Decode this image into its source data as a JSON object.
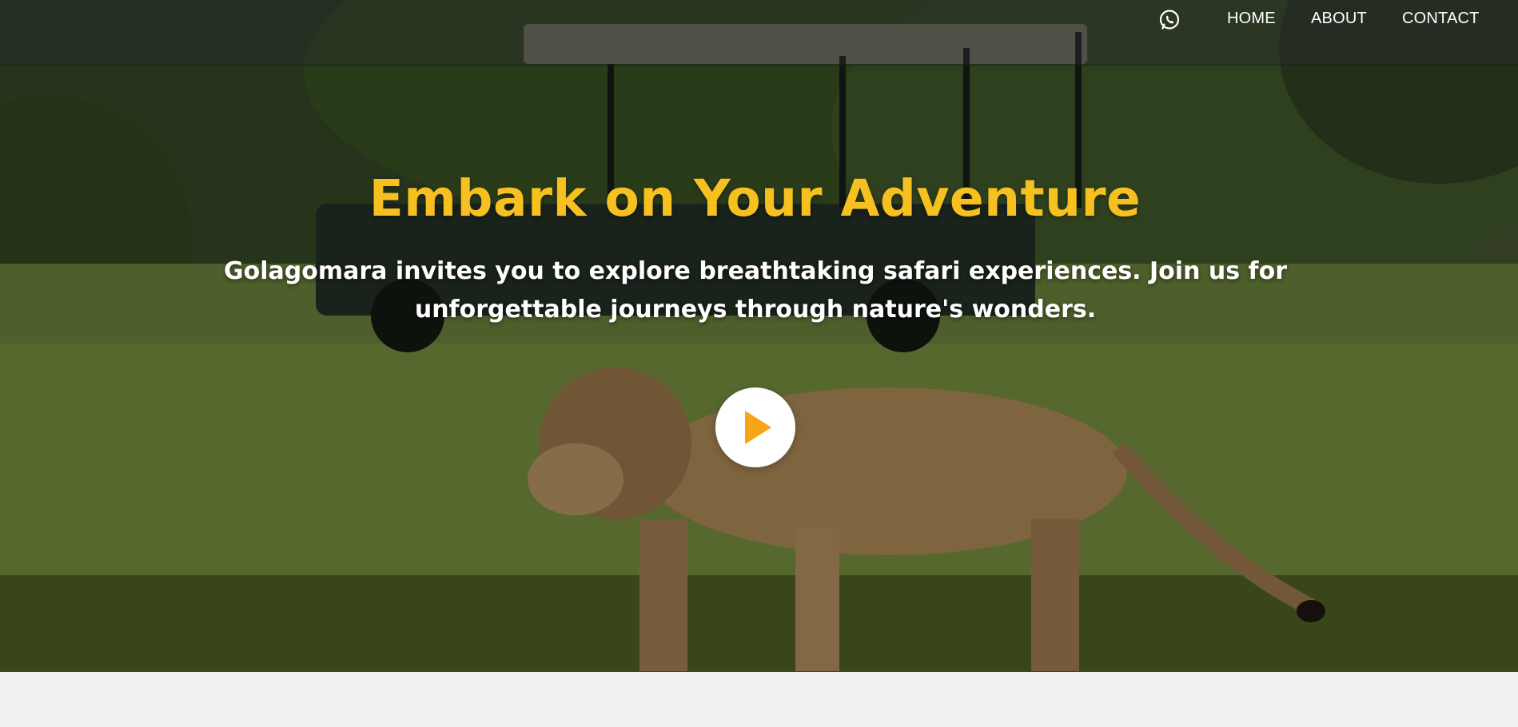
{
  "nav": {
    "whatsapp_icon": "whatsapp-icon",
    "links": [
      {
        "label": "HOME"
      },
      {
        "label": "ABOUT"
      },
      {
        "label": "CONTACT"
      }
    ]
  },
  "hero": {
    "title": "Embark on Your Adventure",
    "subtitle": "Golagomara invites you to explore breathtaking safari experiences. Join us for unforgettable journeys through nature's wonders.",
    "play_icon": "play-icon"
  },
  "colors": {
    "accent": "#f6c120",
    "play": "#f7a516",
    "nav_text": "#ffffff",
    "page_bg": "#f0f0f0"
  }
}
